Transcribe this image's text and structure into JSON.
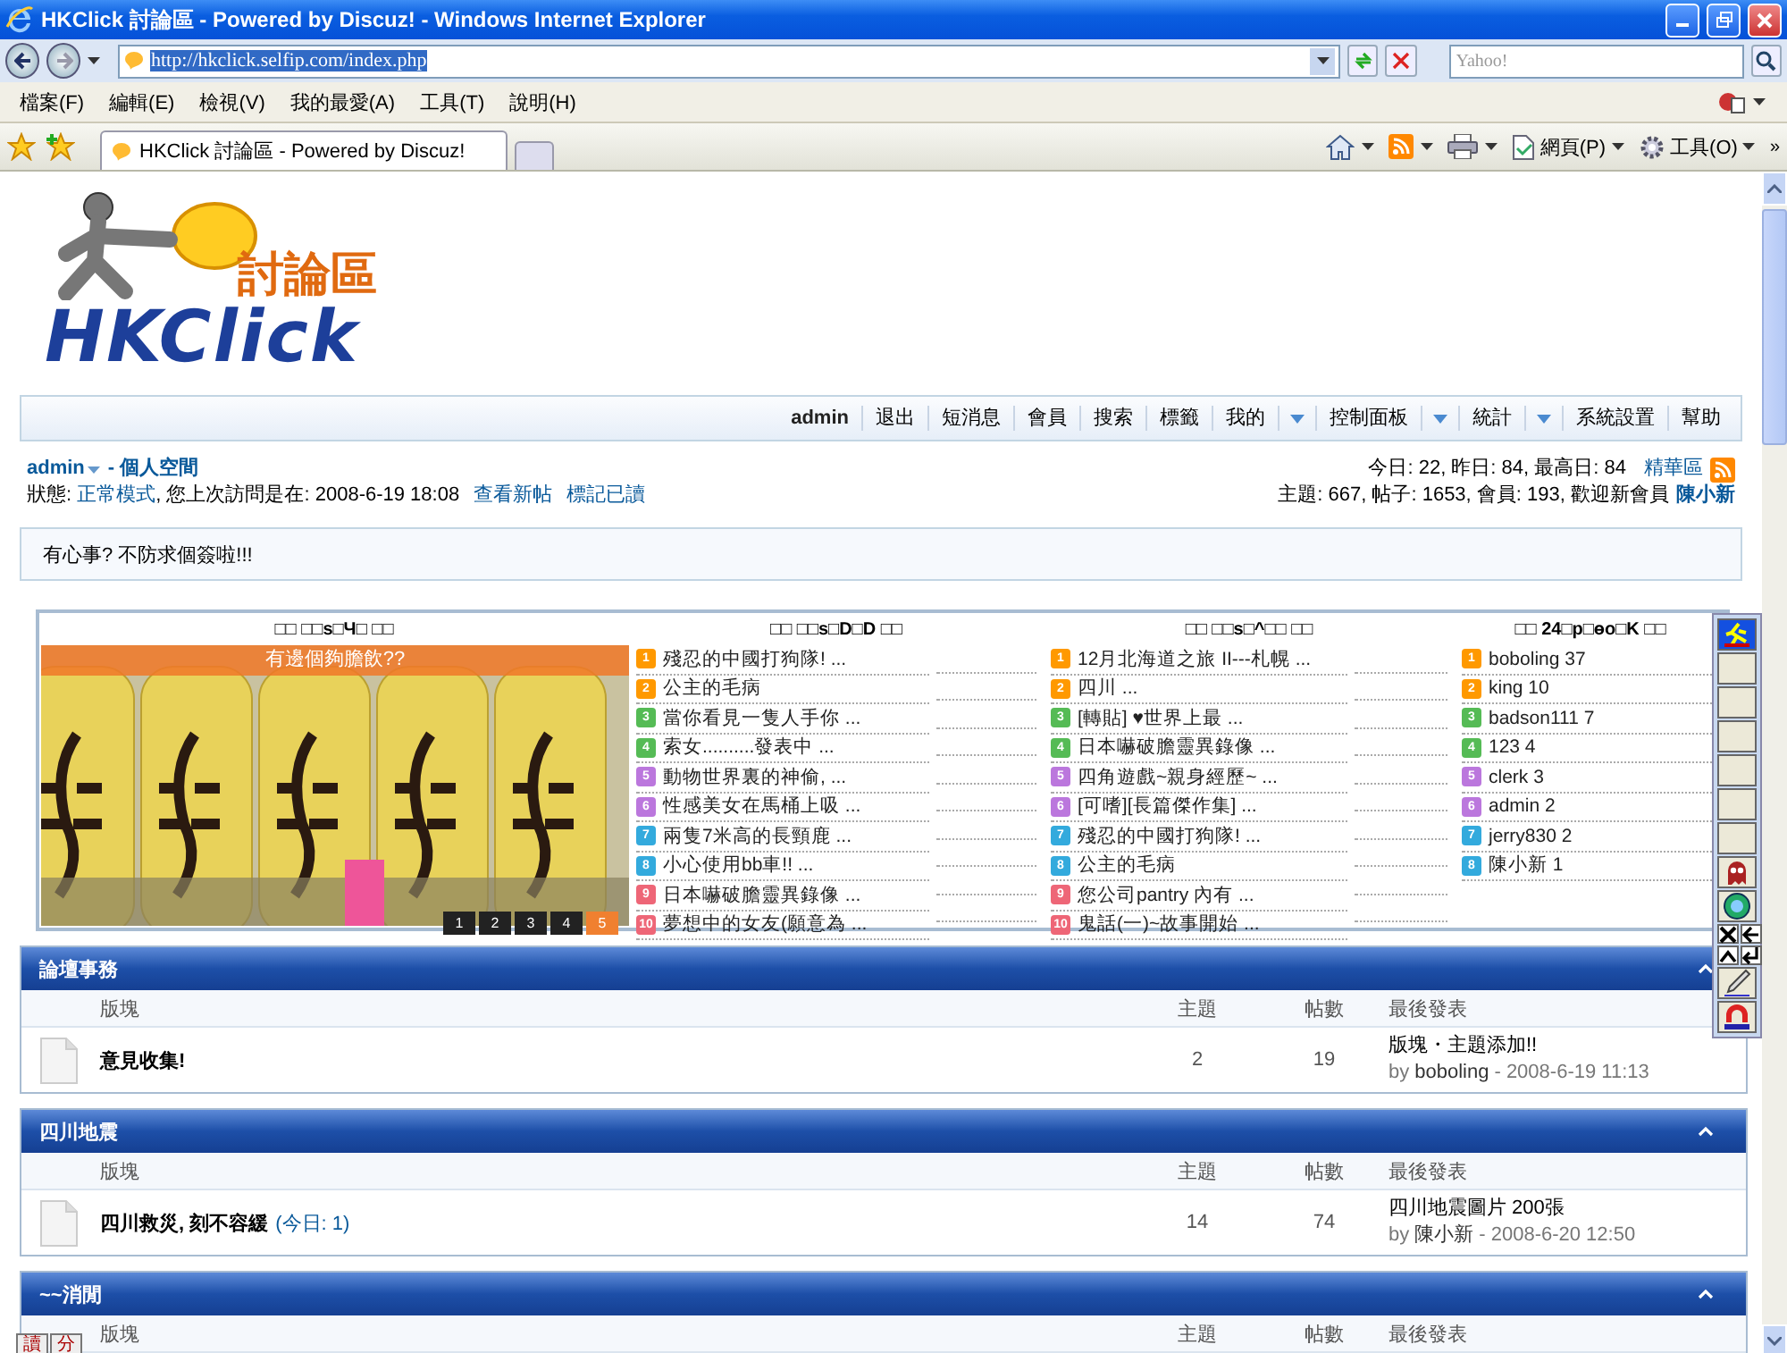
{
  "window": {
    "title": "HKClick 討論區 - Powered by Discuz! - Windows Internet Explorer"
  },
  "address": {
    "value": "http://hkclick.selfip.com/index.php"
  },
  "search": {
    "placeholder": "Yahoo!"
  },
  "menu": [
    "檔案(F)",
    "編輯(E)",
    "檢視(V)",
    "我的最愛(A)",
    "工具(T)",
    "說明(H)"
  ],
  "tabs": [
    {
      "label": "HKClick 討論區 - Powered by Discuz!",
      "selected": true
    }
  ],
  "commands": [
    {
      "kind": "home"
    },
    {
      "kind": "feed"
    },
    {
      "kind": "print"
    },
    {
      "kind": "page",
      "label": "網頁(P)"
    },
    {
      "kind": "tools",
      "label": "工具(O)"
    }
  ],
  "logo": {
    "title": "討論區",
    "name": "HKClick"
  },
  "more": "»",
  "nav_user": "admin",
  "nav": [
    {
      "label": "退出",
      "dropdown": false
    },
    {
      "label": "短消息",
      "dropdown": false
    },
    {
      "label": "會員",
      "dropdown": false
    },
    {
      "label": "搜索",
      "dropdown": false
    },
    {
      "label": "標籤",
      "dropdown": false
    },
    {
      "label": "我的",
      "dropdown": true
    },
    {
      "label": "控制面板",
      "dropdown": true
    },
    {
      "label": "統計",
      "dropdown": true
    },
    {
      "label": "系統設置",
      "dropdown": false
    },
    {
      "label": "幫助",
      "dropdown": false
    }
  ],
  "user": {
    "name": "admin",
    "space": "- 個人空間",
    "status_label": "狀態:",
    "mode": "正常模式",
    "last_visit": ", 您上次訪問是在: 2008-6-19 18:08",
    "links": [
      "查看新帖",
      "標記已讀"
    ]
  },
  "stats": {
    "today": "今日: 22, 昨日: 84, 最高日: 84",
    "digest": "精華區",
    "totals": "主題: 667, 帖子: 1653, 會員: 193, 歡迎新會員",
    "newest": "陳小新"
  },
  "notice": "有心事? 不防求個簽啦!!!",
  "portal": {
    "headings": [
      "□□ □□s□Ч□ □□",
      "□□ □□s□D□D □□",
      "□□ □□s□^□□ □□",
      "□□ 24□p□ɵo□K □□"
    ],
    "picture": {
      "caption": "有邊個夠膽飲??",
      "pages": [
        {
          "label": "1",
          "selected": false
        },
        {
          "label": "2",
          "selected": false
        },
        {
          "label": "3",
          "selected": false
        },
        {
          "label": "4",
          "selected": false
        },
        {
          "label": "5",
          "selected": true
        }
      ]
    },
    "lists": [
      [
        {
          "rank": "1",
          "color": "#ff9900",
          "text": "殘忍的中國打狗隊! ..."
        },
        {
          "rank": "2",
          "color": "#ff9900",
          "text": "公主的毛病"
        },
        {
          "rank": "3",
          "color": "#55bb55",
          "text": "當你看見一隻人手你 ..."
        },
        {
          "rank": "4",
          "color": "#55bb55",
          "text": "索女..........發表中 ..."
        },
        {
          "rank": "5",
          "color": "#bb77dd",
          "text": "動物世界裏的神偷, ..."
        },
        {
          "rank": "6",
          "color": "#bb77dd",
          "text": "性感美女在馬桶上吸 ..."
        },
        {
          "rank": "7",
          "color": "#33aadd",
          "text": "兩隻7米高的長頸鹿 ..."
        },
        {
          "rank": "8",
          "color": "#33aadd",
          "text": "小心使用bb車!! ..."
        },
        {
          "rank": "9",
          "color": "#ee6677",
          "text": "日本嚇破膽靈異錄像 ..."
        },
        {
          "rank": "10",
          "color": "#ee6677",
          "text": "夢想中的女友(願意為 ..."
        }
      ],
      [
        {
          "rank": "1",
          "color": "#ff9900",
          "text": "12月北海道之旅 II---札幌 ..."
        },
        {
          "rank": "2",
          "color": "#ff9900",
          "text": "四川 ..."
        },
        {
          "rank": "3",
          "color": "#55bb55",
          "text": "[轉貼] ♥世界上最 ..."
        },
        {
          "rank": "4",
          "color": "#55bb55",
          "text": "日本嚇破膽靈異錄像 ..."
        },
        {
          "rank": "5",
          "color": "#bb77dd",
          "text": "四角遊戲~親身經歷~ ..."
        },
        {
          "rank": "6",
          "color": "#bb77dd",
          "text": "[可嗜][長篇傑作集] ..."
        },
        {
          "rank": "7",
          "color": "#33aadd",
          "text": "殘忍的中國打狗隊! ..."
        },
        {
          "rank": "8",
          "color": "#33aadd",
          "text": "公主的毛病"
        },
        {
          "rank": "9",
          "color": "#ee6677",
          "text": "您公司pantry 內有 ..."
        },
        {
          "rank": "10",
          "color": "#ee6677",
          "text": "鬼話(一)~故事開始 ..."
        }
      ],
      [
        {
          "rank": "1",
          "color": "#ff9900",
          "text": "boboling 37"
        },
        {
          "rank": "2",
          "color": "#ff9900",
          "text": "king 10"
        },
        {
          "rank": "3",
          "color": "#55bb55",
          "text": "badson111 7"
        },
        {
          "rank": "4",
          "color": "#55bb55",
          "text": "123 4"
        },
        {
          "rank": "5",
          "color": "#bb77dd",
          "text": "clerk 3"
        },
        {
          "rank": "6",
          "color": "#bb77dd",
          "text": "admin 2"
        },
        {
          "rank": "7",
          "color": "#33aadd",
          "text": "jerry830 2"
        },
        {
          "rank": "8",
          "color": "#33aadd",
          "text": "陳小新 1"
        }
      ]
    ]
  },
  "toolbar": [
    {
      "kind": "active"
    },
    {
      "kind": "blank"
    },
    {
      "kind": "blank"
    },
    {
      "kind": "blank"
    },
    {
      "kind": "blank"
    },
    {
      "kind": "blank"
    },
    {
      "kind": "blank"
    },
    {
      "kind": "creature"
    },
    {
      "kind": "globe"
    },
    {
      "kind": "close"
    },
    {
      "kind": "back"
    },
    {
      "kind": "up"
    },
    {
      "kind": "enter"
    },
    {
      "kind": "pen"
    },
    {
      "kind": "magnet"
    }
  ],
  "sections": [
    {
      "title": "論壇事務",
      "columns": [
        "版塊",
        "主題",
        "帖數",
        "最後發表"
      ],
      "forums": [
        {
          "name": "意見收集!",
          "topics": "2",
          "posts": "19",
          "last_title": "版塊・主題添加!!",
          "by": "by",
          "last_by": "boboling",
          "last_time": "- 2008-6-19 11:13"
        }
      ]
    },
    {
      "title": "四川地震",
      "columns": [
        "版塊",
        "主題",
        "帖數",
        "最後發表"
      ],
      "forums": [
        {
          "name": "四川救災, 刻不容緩",
          "today": "(今日: 1)",
          "topics": "14",
          "posts": "74",
          "last_title": "四川地震圖片 200張",
          "by": "by",
          "last_by": "陳小新",
          "last_time": "- 2008-6-20 12:50"
        }
      ]
    },
    {
      "title": "~~消閒",
      "columns": [
        "版塊",
        "主題",
        "帖數",
        "最後發表"
      ]
    }
  ],
  "corner_widget": [
    "讀",
    "分"
  ]
}
